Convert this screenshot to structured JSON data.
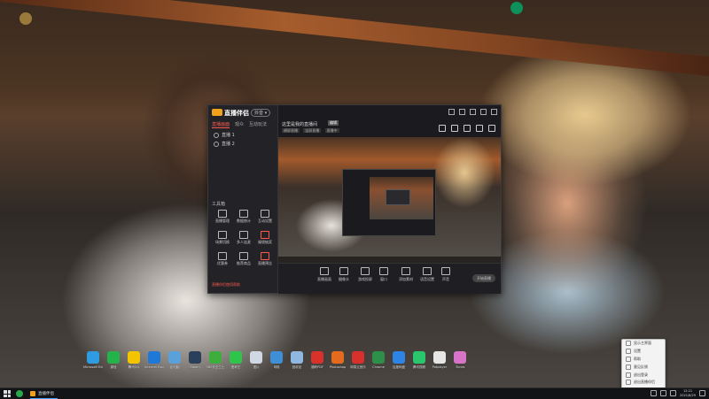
{
  "app": {
    "name": "直播伴侣",
    "version_badge": "抖音 ▾",
    "side_tabs": [
      "直播画面",
      "观众",
      "互动玩法"
    ],
    "scenes": [
      "直播 1",
      "直播 2"
    ],
    "tools_title": "工具箱",
    "tools": [
      {
        "label": "直播管理",
        "icon": "monitor-icon"
      },
      {
        "label": "数据统计",
        "icon": "chart-icon"
      },
      {
        "label": "互动设置",
        "icon": "gear-icon"
      },
      {
        "label": "场景切换",
        "icon": "scene-icon"
      },
      {
        "label": "多人连麦",
        "icon": "people-icon"
      },
      {
        "label": "福袋抽奖",
        "icon": "gift-icon"
      },
      {
        "label": "优惠券",
        "icon": "coupon-icon"
      },
      {
        "label": "推荐商品",
        "icon": "cart-icon"
      },
      {
        "label": "直播预告",
        "icon": "calendar-icon"
      }
    ],
    "footer_link": "直播伴侣使用帮助",
    "room_title": "这里是我的直播间",
    "room_tag": "编辑",
    "room_sub": [
      "横屏直播",
      "竖屏直播",
      "直播中"
    ],
    "controls": [
      "直播画面",
      "摄像头",
      "游戏投屏",
      "窗口",
      "添加素材",
      "语音设置",
      "声音",
      "观众管理"
    ],
    "go_live": "开始直播"
  },
  "desktop_icons": [
    {
      "label": "Microsoft Edge",
      "color": "#2f9be0"
    },
    {
      "label": "微信",
      "color": "#24b24a"
    },
    {
      "label": "腾讯QQ",
      "color": "#f5c400"
    },
    {
      "label": "Internet Explorer",
      "color": "#1e78d7"
    },
    {
      "label": "此电脑",
      "color": "#5ba1d9"
    },
    {
      "label": "Steam",
      "color": "#2a3f5a"
    },
    {
      "label": "360安全卫士",
      "color": "#3dae3d"
    },
    {
      "label": "爱奇艺",
      "color": "#2fc54a"
    },
    {
      "label": "图片",
      "color": "#cfd8e3"
    },
    {
      "label": "网络",
      "color": "#3e8fd6"
    },
    {
      "label": "回收站",
      "color": "#8fb8e0"
    },
    {
      "label": "福昕PDF",
      "color": "#d9322a"
    },
    {
      "label": "Photoshop",
      "color": "#e36a1f"
    },
    {
      "label": "网易云音乐",
      "color": "#d8302c"
    },
    {
      "label": "Chrome",
      "color": "#2d8f4a"
    },
    {
      "label": "百度网盘",
      "color": "#2e84e5"
    },
    {
      "label": "腾讯视频",
      "color": "#2bc66b"
    },
    {
      "label": "Potplayer",
      "color": "#e6e6e6"
    },
    {
      "label": "iTunes",
      "color": "#d874c8"
    }
  ],
  "context_menu": [
    "显示主界面",
    "设置",
    "帮助",
    "意见反馈",
    "退出登录",
    "退出直播伴侣"
  ],
  "taskbar": {
    "task_app_label": "直播伴侣",
    "time": "12:21",
    "date": "2021/6/29"
  }
}
